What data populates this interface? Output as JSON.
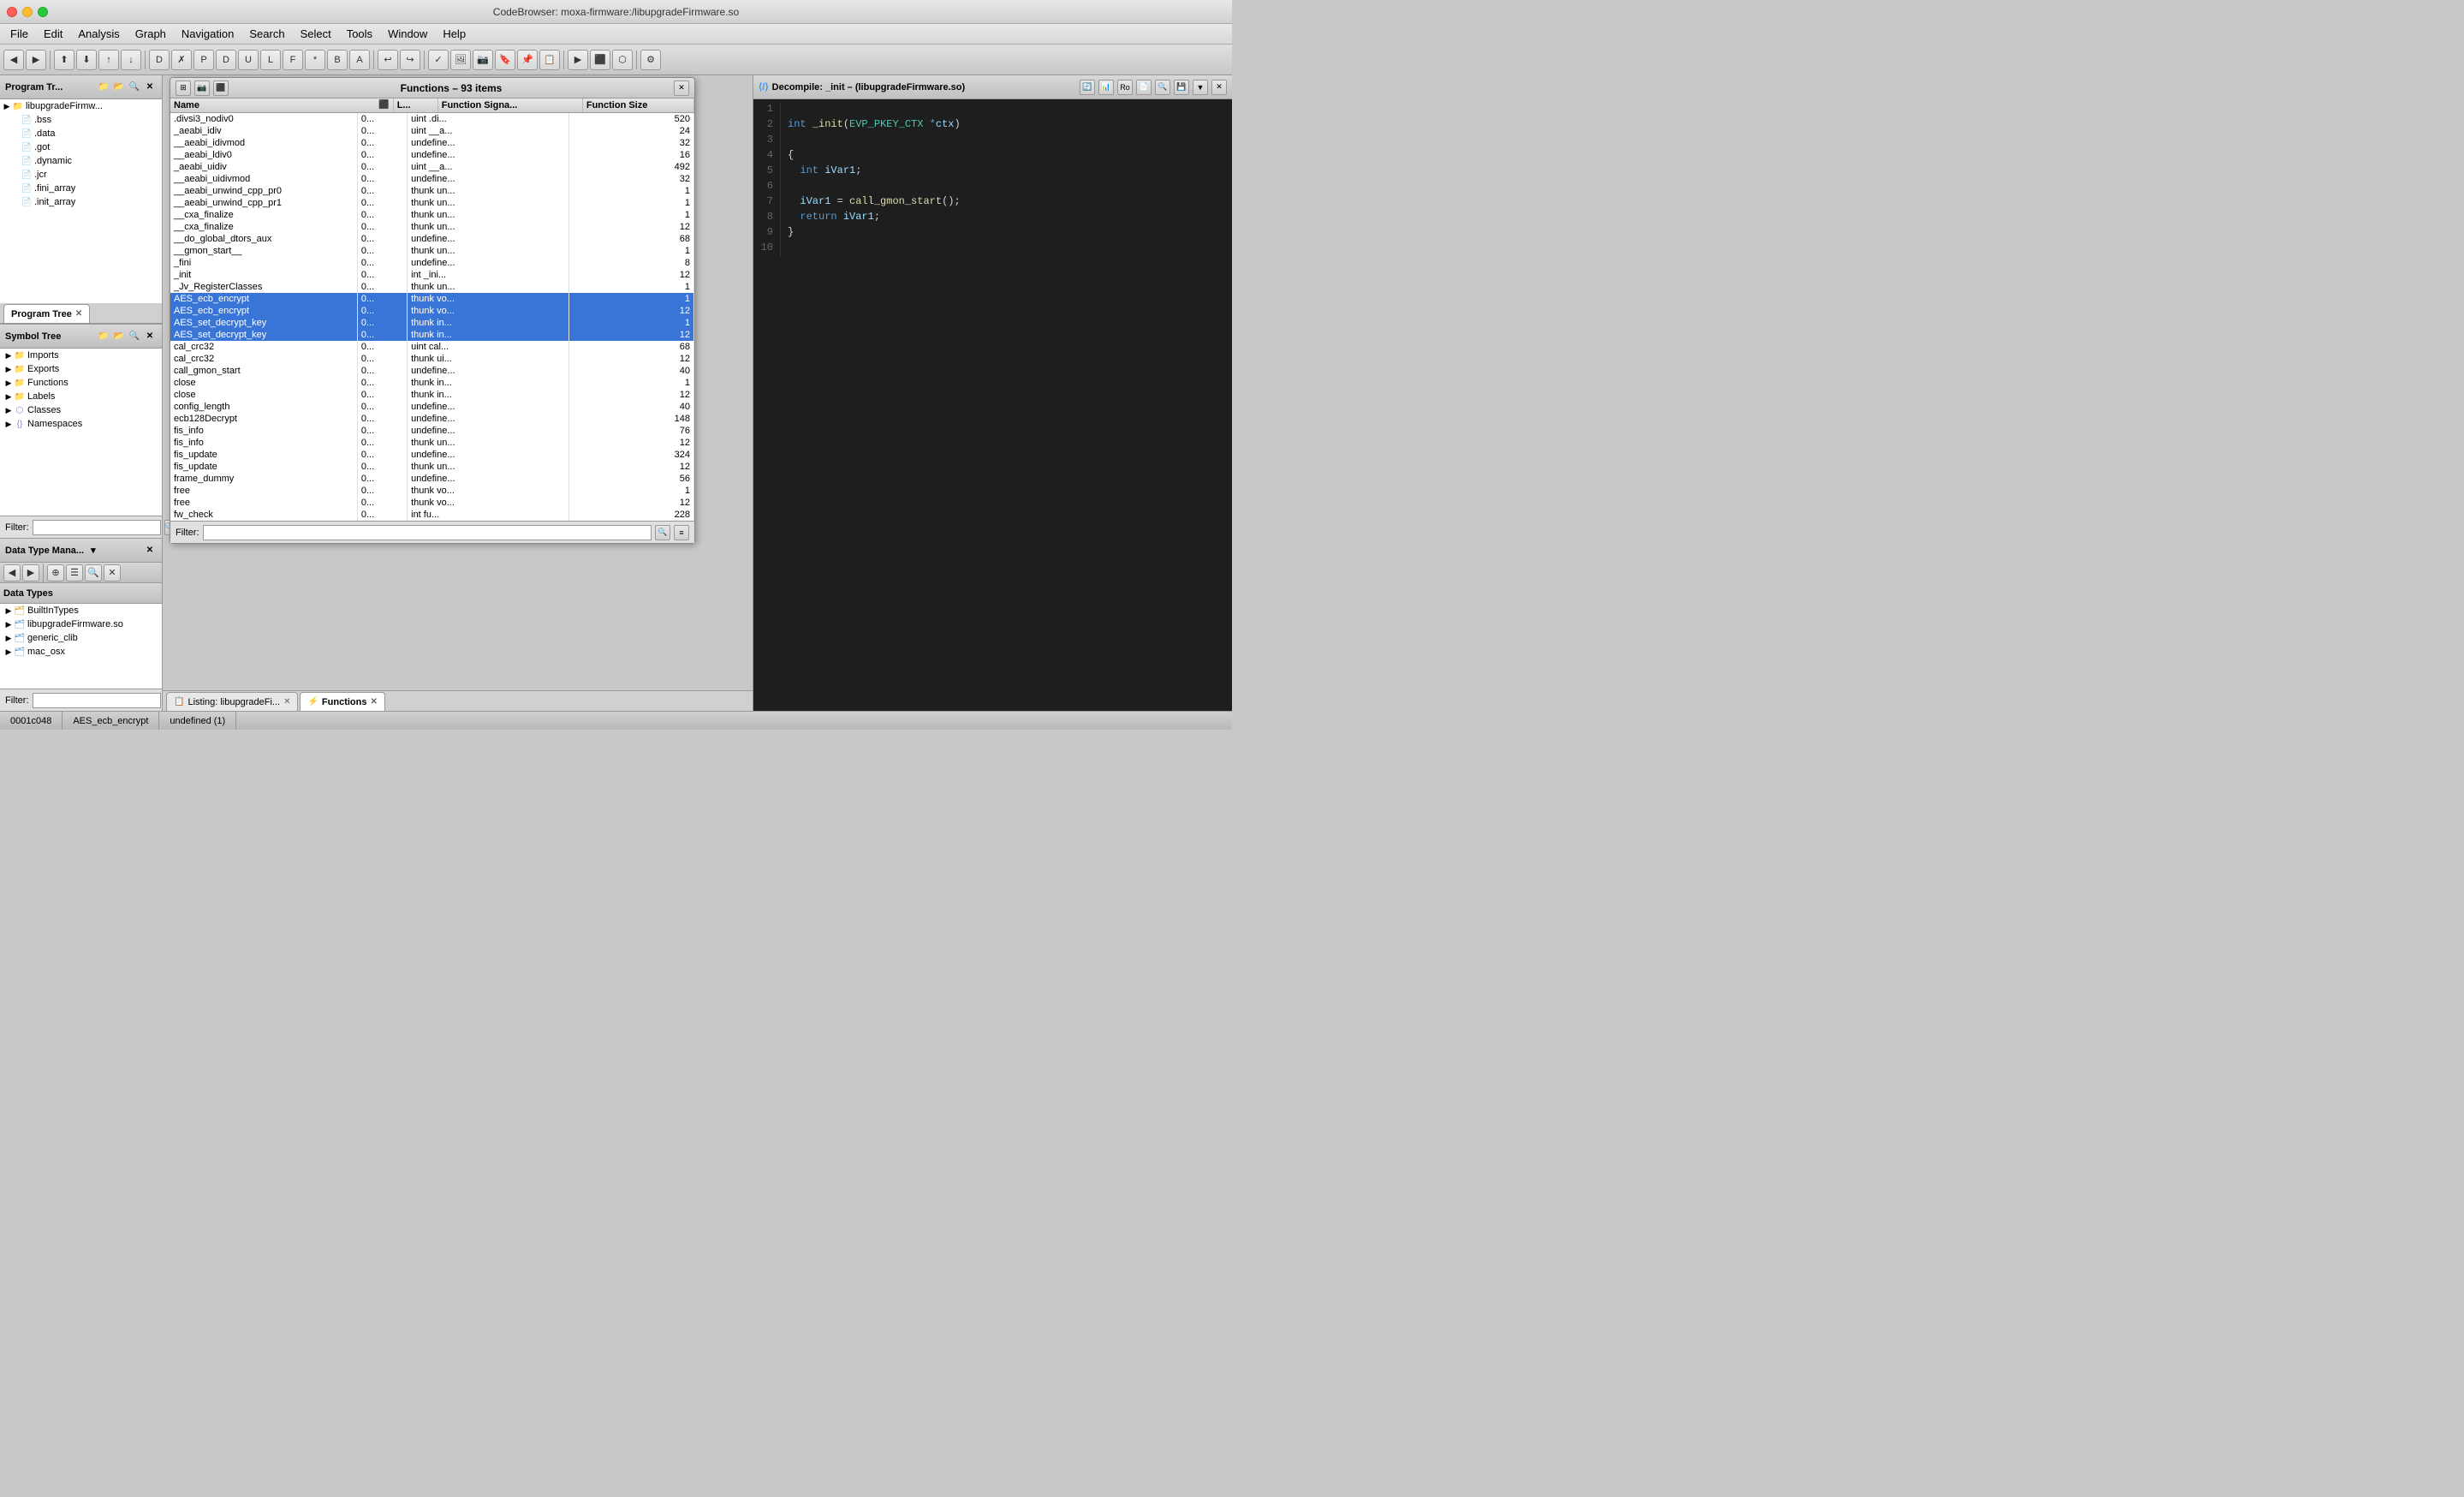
{
  "window": {
    "title": "CodeBrowser: moxa-firmware:/libupgradeFirmware.so",
    "traffic_lights": [
      "close",
      "minimize",
      "maximize"
    ]
  },
  "menu": {
    "items": [
      "File",
      "Edit",
      "Analysis",
      "Graph",
      "Navigation",
      "Search",
      "Select",
      "Tools",
      "Window",
      "Help"
    ]
  },
  "program_tree": {
    "title": "Program Tr...",
    "tab_label": "Program Tree",
    "root": "libupgradeFirmw...",
    "items": [
      {
        "label": ".bss",
        "type": "file",
        "indent": 2
      },
      {
        "label": ".data",
        "type": "file",
        "indent": 2
      },
      {
        "label": ".got",
        "type": "file",
        "indent": 2
      },
      {
        "label": ".dynamic",
        "type": "file",
        "indent": 2
      },
      {
        "label": ".jcr",
        "type": "file",
        "indent": 2
      },
      {
        "label": ".fini_array",
        "type": "file",
        "indent": 2
      },
      {
        "label": ".init_array",
        "type": "file",
        "indent": 2
      }
    ]
  },
  "symbol_tree": {
    "title": "Symbol Tree",
    "items": [
      {
        "label": "Imports",
        "type": "folder",
        "indent": 1
      },
      {
        "label": "Exports",
        "type": "folder",
        "indent": 1
      },
      {
        "label": "Functions",
        "type": "folder",
        "indent": 1
      },
      {
        "label": "Labels",
        "type": "folder",
        "indent": 1
      },
      {
        "label": "Classes",
        "type": "folder",
        "indent": 1
      },
      {
        "label": "Namespaces",
        "type": "folder",
        "indent": 1
      }
    ]
  },
  "data_type_manager": {
    "title": "Data Type Mana...",
    "header": "Data Types",
    "items": [
      {
        "label": "BuiltInTypes",
        "type": "builtin",
        "indent": 1
      },
      {
        "label": "libupgradeFirmware.so",
        "type": "lib",
        "indent": 1
      },
      {
        "label": "generic_clib",
        "type": "lib",
        "indent": 1
      },
      {
        "label": "mac_osx",
        "type": "lib",
        "indent": 1
      }
    ]
  },
  "functions_window": {
    "title": "Functions – 93 items",
    "columns": [
      "Name",
      "L...",
      "Function Signa...",
      "Function Size"
    ],
    "rows": [
      {
        "name": ".divsi3_nodiv0",
        "l": "0...",
        "sig": "uint .di...",
        "size": "520",
        "selected": false
      },
      {
        "name": "_aeabi_idiv",
        "l": "0...",
        "sig": "uint __a...",
        "size": "24",
        "selected": false
      },
      {
        "name": "__aeabi_idivmod",
        "l": "0...",
        "sig": "undefine...",
        "size": "32",
        "selected": false
      },
      {
        "name": "__aeabi_ldiv0",
        "l": "0...",
        "sig": "undefine...",
        "size": "16",
        "selected": false
      },
      {
        "name": "_aeabi_uidiv",
        "l": "0...",
        "sig": "uint __a...",
        "size": "492",
        "selected": false
      },
      {
        "name": "__aeabi_uidivmod",
        "l": "0...",
        "sig": "undefine...",
        "size": "32",
        "selected": false
      },
      {
        "name": "__aeabi_unwind_cpp_pr0",
        "l": "0...",
        "sig": "thunk un...",
        "size": "1",
        "selected": false
      },
      {
        "name": "__aeabi_unwind_cpp_pr1",
        "l": "0...",
        "sig": "thunk un...",
        "size": "1",
        "selected": false
      },
      {
        "name": "__cxa_finalize",
        "l": "0...",
        "sig": "thunk un...",
        "size": "1",
        "selected": false
      },
      {
        "name": "__cxa_finalize",
        "l": "0...",
        "sig": "thunk un...",
        "size": "12",
        "selected": false
      },
      {
        "name": "__do_global_dtors_aux",
        "l": "0...",
        "sig": "undefine...",
        "size": "68",
        "selected": false
      },
      {
        "name": "__gmon_start__",
        "l": "0...",
        "sig": "thunk un...",
        "size": "1",
        "selected": false
      },
      {
        "name": "_fini",
        "l": "0...",
        "sig": "undefine...",
        "size": "8",
        "selected": false
      },
      {
        "name": "_init",
        "l": "0...",
        "sig": "int _ini...",
        "size": "12",
        "selected": false
      },
      {
        "name": "_Jv_RegisterClasses",
        "l": "0...",
        "sig": "thunk un...",
        "size": "1",
        "selected": false
      },
      {
        "name": "AES_ecb_encrypt",
        "l": "0...",
        "sig": "thunk vo...",
        "size": "1",
        "selected": true
      },
      {
        "name": "AES_ecb_encrypt",
        "l": "0...",
        "sig": "thunk vo...",
        "size": "12",
        "selected": true
      },
      {
        "name": "AES_set_decrypt_key",
        "l": "0...",
        "sig": "thunk in...",
        "size": "1",
        "selected": true
      },
      {
        "name": "AES_set_decrypt_key",
        "l": "0...",
        "sig": "thunk in...",
        "size": "12",
        "selected": true
      },
      {
        "name": "cal_crc32",
        "l": "0...",
        "sig": "uint cal...",
        "size": "68",
        "selected": false
      },
      {
        "name": "cal_crc32",
        "l": "0...",
        "sig": "thunk ui...",
        "size": "12",
        "selected": false
      },
      {
        "name": "call_gmon_start",
        "l": "0...",
        "sig": "undefine...",
        "size": "40",
        "selected": false
      },
      {
        "name": "close",
        "l": "0...",
        "sig": "thunk in...",
        "size": "1",
        "selected": false
      },
      {
        "name": "close",
        "l": "0...",
        "sig": "thunk in...",
        "size": "12",
        "selected": false
      },
      {
        "name": "config_length",
        "l": "0...",
        "sig": "undefine...",
        "size": "40",
        "selected": false
      },
      {
        "name": "ecb128Decrypt",
        "l": "0...",
        "sig": "undefine...",
        "size": "148",
        "selected": false
      },
      {
        "name": "fis_info",
        "l": "0...",
        "sig": "undefine...",
        "size": "76",
        "selected": false
      },
      {
        "name": "fis_info",
        "l": "0...",
        "sig": "thunk un...",
        "size": "12",
        "selected": false
      },
      {
        "name": "fis_update",
        "l": "0...",
        "sig": "undefine...",
        "size": "324",
        "selected": false
      },
      {
        "name": "fis_update",
        "l": "0...",
        "sig": "thunk un...",
        "size": "12",
        "selected": false
      },
      {
        "name": "frame_dummy",
        "l": "0...",
        "sig": "undefine...",
        "size": "56",
        "selected": false
      },
      {
        "name": "free",
        "l": "0...",
        "sig": "thunk vo...",
        "size": "1",
        "selected": false
      },
      {
        "name": "free",
        "l": "0...",
        "sig": "thunk vo...",
        "size": "12",
        "selected": false
      },
      {
        "name": "fw_check",
        "l": "0...",
        "sig": "int fu...",
        "size": "228",
        "selected": false
      }
    ],
    "filter_placeholder": "Filter:"
  },
  "decompile": {
    "title": "Decompile: _init – (libupgradeFirmware.so)",
    "lines": [
      {
        "num": "1",
        "content": ""
      },
      {
        "num": "2",
        "content": "int _init(EVP_PKEY_CTX *ctx)"
      },
      {
        "num": "3",
        "content": ""
      },
      {
        "num": "4",
        "content": "{"
      },
      {
        "num": "5",
        "content": "  int iVar1;"
      },
      {
        "num": "6",
        "content": ""
      },
      {
        "num": "7",
        "content": "  iVar1 = call_gmon_start();"
      },
      {
        "num": "8",
        "content": "  return iVar1;"
      },
      {
        "num": "9",
        "content": "}"
      },
      {
        "num": "10",
        "content": ""
      }
    ]
  },
  "bottom_tabs": {
    "items": [
      {
        "label": "Listing: libupgradeFi...",
        "active": false
      },
      {
        "label": "Functions",
        "active": true
      }
    ]
  },
  "status_bar": {
    "segments": [
      "0001c048",
      "AES_ecb_encrypt",
      "undefined (1)"
    ]
  },
  "filter": {
    "label": "Filter:"
  }
}
